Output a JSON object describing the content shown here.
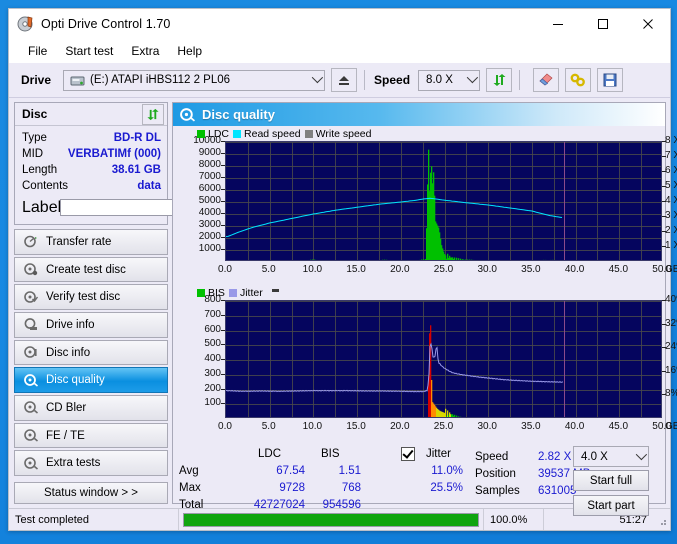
{
  "window": {
    "title": "Opti Drive Control 1.70",
    "icon": "disc-icon",
    "minimize": "–",
    "maximize": "□",
    "close": "✕"
  },
  "menu": {
    "items": [
      "File",
      "Start test",
      "Extra",
      "Help"
    ]
  },
  "toolbar": {
    "drive_label": "Drive",
    "drive_value": "(E:)  ATAPI iHBS112  2 PL06",
    "eject_icon": "eject-icon",
    "speed_label": "Speed",
    "speed_value": "8.0 X",
    "refresh_icon": "refresh-icon",
    "erase_icon": "eraser-icon",
    "link_icon": "link-icon",
    "save_icon": "save-icon"
  },
  "disc_panel": {
    "title": "Disc",
    "refresh_icon": "refresh-icon",
    "rows": [
      {
        "key": "Type",
        "value": "BD-R DL"
      },
      {
        "key": "MID",
        "value": "VERBATIMf (000)"
      },
      {
        "key": "Length",
        "value": "38.61 GB"
      },
      {
        "key": "Contents",
        "value": "data"
      }
    ],
    "label_key": "Label",
    "label_value": "",
    "label_placeholder": "",
    "disc_icon": "cd-icon"
  },
  "sidebar": {
    "items": [
      {
        "label": "Transfer rate",
        "icon": "gauge-icon",
        "active": false
      },
      {
        "label": "Create test disc",
        "icon": "burn-icon",
        "active": false
      },
      {
        "label": "Verify test disc",
        "icon": "verify-icon",
        "active": false
      },
      {
        "label": "Drive info",
        "icon": "drive-icon",
        "active": false
      },
      {
        "label": "Disc info",
        "icon": "disc-info-icon",
        "active": false
      },
      {
        "label": "Disc quality",
        "icon": "quality-icon",
        "active": true
      },
      {
        "label": "CD Bler",
        "icon": "bler-icon",
        "active": false
      },
      {
        "label": "FE / TE",
        "icon": "fete-icon",
        "active": false
      },
      {
        "label": "Extra tests",
        "icon": "extra-icon",
        "active": false
      }
    ],
    "status_window": "Status window > >"
  },
  "main": {
    "header_title": "Disc quality",
    "header_icon": "quality-icon"
  },
  "stats": {
    "col_ldc": "LDC",
    "col_bis": "BIS",
    "jitter_label": "Jitter",
    "jitter_checked": true,
    "row_avg": "Avg",
    "row_max": "Max",
    "row_total": "Total",
    "avg_ldc": "67.54",
    "avg_bis": "1.51",
    "avg_jitter": "11.0%",
    "max_ldc": "9728",
    "max_bis": "768",
    "max_jitter": "25.5%",
    "total_ldc": "42727024",
    "total_bis": "954596",
    "speed_label": "Speed",
    "speed_value": "2.82 X",
    "position_label": "Position",
    "position_value": "39537 MB",
    "samples_label": "Samples",
    "samples_value": "631005",
    "scan_speed": "4.0 X",
    "start_full": "Start full",
    "start_part": "Start part"
  },
  "statusbar": {
    "message": "Test completed",
    "progress_percent": "100.0%",
    "progress_value": 100,
    "elapsed": "51:27"
  },
  "colors": {
    "ldc": "#00c000",
    "bis": "#00c000",
    "read_speed": "#00e5ff",
    "write_speed": "#808080",
    "jitter": "#9999e8",
    "plot_bg": "#05055e",
    "accent": "#1a1ad0",
    "progress": "#10a510"
  },
  "chart_data": [
    {
      "type": "line",
      "title": "LDC / Read speed / Write speed",
      "legend": [
        {
          "name": "LDC",
          "color": "#00c000"
        },
        {
          "name": "Read speed",
          "color": "#00e5ff"
        },
        {
          "name": "Write speed",
          "color": "#808080"
        }
      ],
      "legend_position": "top-left",
      "xlabel": "GB",
      "xlim": [
        0.0,
        50.0
      ],
      "xticks": [
        "0.0",
        "5.0",
        "10.0",
        "15.0",
        "20.0",
        "25.0",
        "30.0",
        "35.0",
        "40.0",
        "45.0",
        "50.0"
      ],
      "ylabel_left": "LDC",
      "ylim_left": [
        0,
        10000
      ],
      "yticks_left": [
        "1000",
        "2000",
        "3000",
        "4000",
        "5000",
        "6000",
        "7000",
        "8000",
        "9000",
        "10000"
      ],
      "ylabel_right": "X",
      "ylim_right": [
        0,
        8
      ],
      "yticks_right": [
        "1 X",
        "2 X",
        "3 X",
        "4 X",
        "5 X",
        "6 X",
        "7 X",
        "8 X"
      ],
      "grid": true,
      "series": [
        {
          "name": "Read speed",
          "color": "#00e5ff",
          "axis": "right",
          "x": [
            0.2,
            1.5,
            3.0,
            5.0,
            7.5,
            10.0,
            12.5,
            15.0,
            17.5,
            20.0,
            21.5,
            22.6,
            23.3,
            24.0,
            25.0,
            27.5,
            30.0,
            32.5,
            35.0,
            37.0,
            38.6
          ],
          "y": [
            1.7,
            2.0,
            2.3,
            2.6,
            2.9,
            3.2,
            3.45,
            3.65,
            3.85,
            4.0,
            4.1,
            4.2,
            4.25,
            4.2,
            4.12,
            3.95,
            3.8,
            3.6,
            3.4,
            3.1,
            2.95
          ]
        },
        {
          "name": "LDC",
          "color": "#00c000",
          "axis": "left",
          "note": "near-zero baseline across disc with a large spike cluster at 23-26 GB peaking near 9728",
          "x": [
            0.0,
            2.0,
            4.0,
            6.0,
            8.0,
            10.0,
            12.0,
            14.0,
            16.0,
            18.0,
            20.0,
            21.0,
            22.0,
            22.8,
            23.1,
            23.25,
            23.4,
            23.55,
            23.7,
            23.9,
            24.1,
            24.3,
            24.6,
            24.9,
            25.2,
            25.6,
            26.0,
            26.5,
            27.5,
            29.0,
            31.0,
            34.0,
            37.0,
            38.5
          ],
          "y": [
            40,
            60,
            50,
            70,
            55,
            120,
            60,
            90,
            70,
            110,
            80,
            70,
            90,
            160,
            9728,
            5200,
            8900,
            6400,
            7600,
            3400,
            3100,
            2800,
            1400,
            700,
            420,
            300,
            230,
            180,
            120,
            90,
            70,
            60,
            110,
            70
          ]
        },
        {
          "name": "Write speed",
          "color": "#808080",
          "axis": "right",
          "x": [],
          "y": []
        }
      ]
    },
    {
      "type": "line",
      "title": "BIS / Jitter",
      "legend": [
        {
          "name": "BIS",
          "color": "#00c000"
        },
        {
          "name": "Jitter",
          "color": "#9999e8"
        }
      ],
      "legend_position": "top-left",
      "xlabel": "GB",
      "xlim": [
        0.0,
        50.0
      ],
      "xticks": [
        "0.0",
        "5.0",
        "10.0",
        "15.0",
        "20.0",
        "25.0",
        "30.0",
        "35.0",
        "40.0",
        "45.0",
        "50.0"
      ],
      "ylabel_left": "BIS",
      "ylim_left": [
        0,
        800
      ],
      "yticks_left": [
        "100",
        "200",
        "300",
        "400",
        "500",
        "600",
        "700",
        "800"
      ],
      "ylabel_right": "Jitter %",
      "ylim_right": [
        0,
        40
      ],
      "yticks_right": [
        "8%",
        "16%",
        "24%",
        "32%",
        "40%"
      ],
      "grid": true,
      "series": [
        {
          "name": "Jitter",
          "color": "#9999e8",
          "axis": "right",
          "x": [
            0.2,
            2.0,
            4.0,
            6.0,
            8.0,
            10.0,
            12.0,
            14.0,
            16.0,
            18.0,
            20.0,
            21.5,
            22.5,
            23.0,
            23.2,
            23.35,
            23.5,
            23.7,
            23.9,
            24.1,
            24.3,
            24.5,
            24.7,
            25.0,
            25.5,
            26.0,
            27.0,
            28.0,
            29.0,
            30.0,
            31.5,
            33.0,
            35.0,
            37.0,
            38.6
          ],
          "y": [
            9.6,
            9.4,
            9.5,
            9.4,
            9.5,
            9.6,
            9.6,
            9.6,
            9.5,
            9.5,
            9.4,
            9.3,
            9.3,
            9.6,
            13.0,
            25.5,
            25.3,
            20.8,
            21.0,
            25.4,
            19.0,
            18.6,
            17.9,
            17.2,
            16.3,
            15.6,
            15.0,
            14.6,
            14.2,
            13.9,
            13.4,
            13.1,
            12.8,
            12.6,
            12.5
          ]
        },
        {
          "name": "BIS",
          "color": "#00c000",
          "axis": "left",
          "note": "flat near zero across disc; dense red/orange error cluster between 23.3 and 26.5 GB peaking at 768",
          "x": [
            0.0,
            5.0,
            10.0,
            15.0,
            20.0,
            23.0,
            23.3,
            23.5,
            23.8,
            24.1,
            24.4,
            24.8,
            25.2,
            25.6,
            26.0,
            26.5,
            28.0,
            32.0,
            36.0,
            38.5
          ],
          "y": [
            2,
            2,
            2,
            2,
            2,
            4,
            768,
            120,
            95,
            70,
            55,
            45,
            35,
            26,
            18,
            10,
            4,
            3,
            3,
            3
          ]
        }
      ]
    }
  ]
}
